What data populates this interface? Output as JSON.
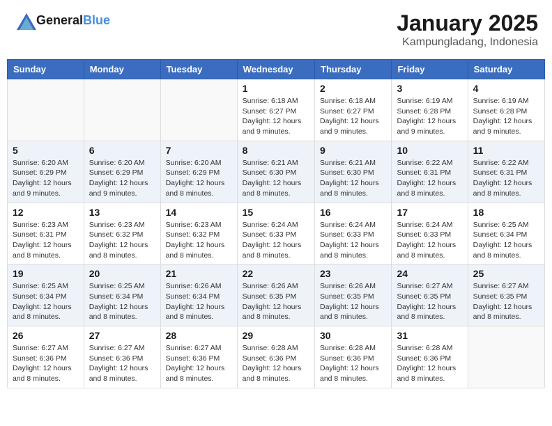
{
  "header": {
    "logo_line1": "General",
    "logo_line2": "Blue",
    "month_title": "January 2025",
    "location": "Kampungladang, Indonesia"
  },
  "days_of_week": [
    "Sunday",
    "Monday",
    "Tuesday",
    "Wednesday",
    "Thursday",
    "Friday",
    "Saturday"
  ],
  "weeks": [
    {
      "row_style": "week-row",
      "days": [
        {
          "num": "",
          "detail": ""
        },
        {
          "num": "",
          "detail": ""
        },
        {
          "num": "",
          "detail": ""
        },
        {
          "num": "1",
          "detail": "Sunrise: 6:18 AM\nSunset: 6:27 PM\nDaylight: 12 hours and 9 minutes."
        },
        {
          "num": "2",
          "detail": "Sunrise: 6:18 AM\nSunset: 6:27 PM\nDaylight: 12 hours and 9 minutes."
        },
        {
          "num": "3",
          "detail": "Sunrise: 6:19 AM\nSunset: 6:28 PM\nDaylight: 12 hours and 9 minutes."
        },
        {
          "num": "4",
          "detail": "Sunrise: 6:19 AM\nSunset: 6:28 PM\nDaylight: 12 hours and 9 minutes."
        }
      ]
    },
    {
      "row_style": "week-row-alt",
      "days": [
        {
          "num": "5",
          "detail": "Sunrise: 6:20 AM\nSunset: 6:29 PM\nDaylight: 12 hours and 9 minutes."
        },
        {
          "num": "6",
          "detail": "Sunrise: 6:20 AM\nSunset: 6:29 PM\nDaylight: 12 hours and 9 minutes."
        },
        {
          "num": "7",
          "detail": "Sunrise: 6:20 AM\nSunset: 6:29 PM\nDaylight: 12 hours and 8 minutes."
        },
        {
          "num": "8",
          "detail": "Sunrise: 6:21 AM\nSunset: 6:30 PM\nDaylight: 12 hours and 8 minutes."
        },
        {
          "num": "9",
          "detail": "Sunrise: 6:21 AM\nSunset: 6:30 PM\nDaylight: 12 hours and 8 minutes."
        },
        {
          "num": "10",
          "detail": "Sunrise: 6:22 AM\nSunset: 6:31 PM\nDaylight: 12 hours and 8 minutes."
        },
        {
          "num": "11",
          "detail": "Sunrise: 6:22 AM\nSunset: 6:31 PM\nDaylight: 12 hours and 8 minutes."
        }
      ]
    },
    {
      "row_style": "week-row",
      "days": [
        {
          "num": "12",
          "detail": "Sunrise: 6:23 AM\nSunset: 6:31 PM\nDaylight: 12 hours and 8 minutes."
        },
        {
          "num": "13",
          "detail": "Sunrise: 6:23 AM\nSunset: 6:32 PM\nDaylight: 12 hours and 8 minutes."
        },
        {
          "num": "14",
          "detail": "Sunrise: 6:23 AM\nSunset: 6:32 PM\nDaylight: 12 hours and 8 minutes."
        },
        {
          "num": "15",
          "detail": "Sunrise: 6:24 AM\nSunset: 6:33 PM\nDaylight: 12 hours and 8 minutes."
        },
        {
          "num": "16",
          "detail": "Sunrise: 6:24 AM\nSunset: 6:33 PM\nDaylight: 12 hours and 8 minutes."
        },
        {
          "num": "17",
          "detail": "Sunrise: 6:24 AM\nSunset: 6:33 PM\nDaylight: 12 hours and 8 minutes."
        },
        {
          "num": "18",
          "detail": "Sunrise: 6:25 AM\nSunset: 6:34 PM\nDaylight: 12 hours and 8 minutes."
        }
      ]
    },
    {
      "row_style": "week-row-alt",
      "days": [
        {
          "num": "19",
          "detail": "Sunrise: 6:25 AM\nSunset: 6:34 PM\nDaylight: 12 hours and 8 minutes."
        },
        {
          "num": "20",
          "detail": "Sunrise: 6:25 AM\nSunset: 6:34 PM\nDaylight: 12 hours and 8 minutes."
        },
        {
          "num": "21",
          "detail": "Sunrise: 6:26 AM\nSunset: 6:34 PM\nDaylight: 12 hours and 8 minutes."
        },
        {
          "num": "22",
          "detail": "Sunrise: 6:26 AM\nSunset: 6:35 PM\nDaylight: 12 hours and 8 minutes."
        },
        {
          "num": "23",
          "detail": "Sunrise: 6:26 AM\nSunset: 6:35 PM\nDaylight: 12 hours and 8 minutes."
        },
        {
          "num": "24",
          "detail": "Sunrise: 6:27 AM\nSunset: 6:35 PM\nDaylight: 12 hours and 8 minutes."
        },
        {
          "num": "25",
          "detail": "Sunrise: 6:27 AM\nSunset: 6:35 PM\nDaylight: 12 hours and 8 minutes."
        }
      ]
    },
    {
      "row_style": "week-row",
      "days": [
        {
          "num": "26",
          "detail": "Sunrise: 6:27 AM\nSunset: 6:36 PM\nDaylight: 12 hours and 8 minutes."
        },
        {
          "num": "27",
          "detail": "Sunrise: 6:27 AM\nSunset: 6:36 PM\nDaylight: 12 hours and 8 minutes."
        },
        {
          "num": "28",
          "detail": "Sunrise: 6:27 AM\nSunset: 6:36 PM\nDaylight: 12 hours and 8 minutes."
        },
        {
          "num": "29",
          "detail": "Sunrise: 6:28 AM\nSunset: 6:36 PM\nDaylight: 12 hours and 8 minutes."
        },
        {
          "num": "30",
          "detail": "Sunrise: 6:28 AM\nSunset: 6:36 PM\nDaylight: 12 hours and 8 minutes."
        },
        {
          "num": "31",
          "detail": "Sunrise: 6:28 AM\nSunset: 6:36 PM\nDaylight: 12 hours and 8 minutes."
        },
        {
          "num": "",
          "detail": ""
        }
      ]
    }
  ]
}
